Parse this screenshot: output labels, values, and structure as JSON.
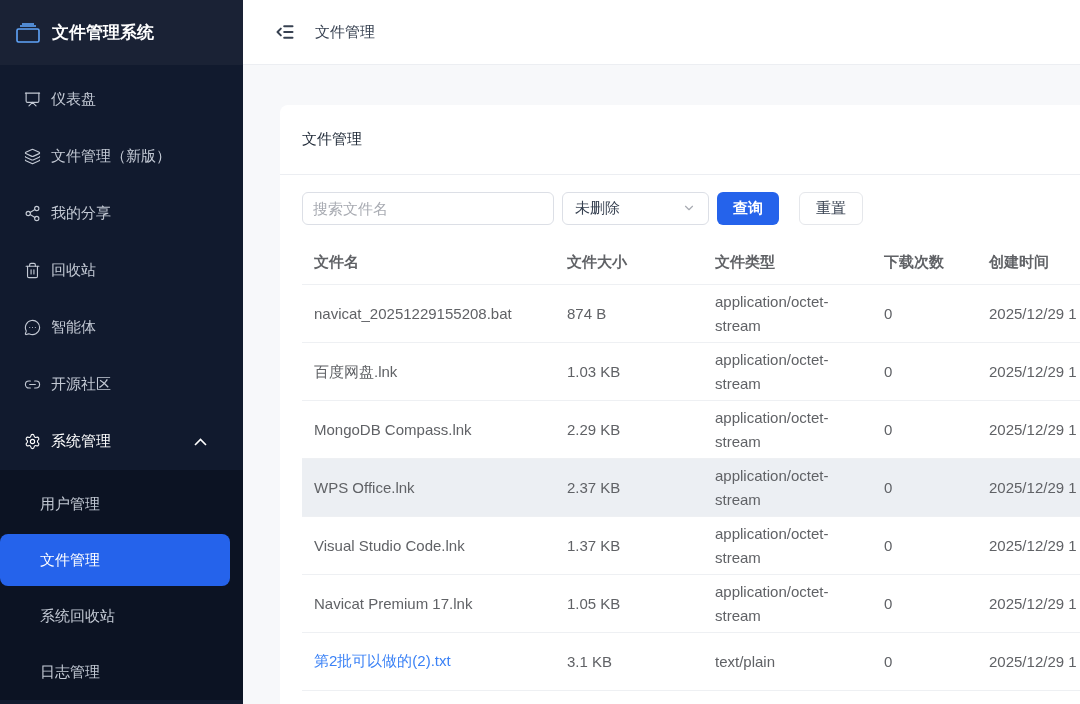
{
  "app": {
    "title": "文件管理系统"
  },
  "sidebar": {
    "items": [
      {
        "label": "仪表盘",
        "selected": false
      },
      {
        "label": "文件管理（新版）",
        "selected": false
      },
      {
        "label": "我的分享",
        "selected": false
      },
      {
        "label": "回收站",
        "selected": false
      },
      {
        "label": "智能体",
        "selected": false
      },
      {
        "label": "开源社区",
        "selected": false
      },
      {
        "label": "系统管理",
        "selected": false,
        "expanded": true,
        "children": [
          {
            "label": "用户管理",
            "selected": false
          },
          {
            "label": "文件管理",
            "selected": true
          },
          {
            "label": "系统回收站",
            "selected": false
          },
          {
            "label": "日志管理",
            "selected": false
          }
        ]
      }
    ]
  },
  "breadcrumb": "文件管理",
  "card": {
    "title": "文件管理"
  },
  "filters": {
    "search": {
      "placeholder": "搜索文件名"
    },
    "status": {
      "value": "未删除"
    },
    "buttons": [
      {
        "label": "查询",
        "kind": "primary"
      },
      {
        "label": "重置",
        "kind": "default"
      }
    ]
  },
  "table": {
    "columns": [
      "文件名",
      "文件大小",
      "文件类型",
      "下载次数",
      "创建时间"
    ],
    "rows": [
      {
        "kind": "text",
        "highlighted": false,
        "cells": [
          "navicat_20251229155208.bat",
          "874 B",
          "application/octet-stream",
          "0",
          "2025/12/29 1"
        ]
      },
      {
        "kind": "text",
        "highlighted": false,
        "cells": [
          "百度网盘.lnk",
          "1.03 KB",
          "application/octet-stream",
          "0",
          "2025/12/29 1"
        ]
      },
      {
        "kind": "text",
        "highlighted": false,
        "cells": [
          "MongoDB Compass.lnk",
          "2.29 KB",
          "application/octet-stream",
          "0",
          "2025/12/29 1"
        ]
      },
      {
        "kind": "text",
        "highlighted": true,
        "cells": [
          "WPS Office.lnk",
          "2.37 KB",
          "application/octet-stream",
          "0",
          "2025/12/29 1"
        ]
      },
      {
        "kind": "text",
        "highlighted": false,
        "cells": [
          "Visual Studio Code.lnk",
          "1.37 KB",
          "application/octet-stream",
          "0",
          "2025/12/29 1"
        ]
      },
      {
        "kind": "text",
        "highlighted": false,
        "cells": [
          "Navicat Premium 17.lnk",
          "1.05 KB",
          "application/octet-stream",
          "0",
          "2025/12/29 1"
        ]
      },
      {
        "kind": "link",
        "highlighted": false,
        "cells": [
          "第2批可以做的(2).txt",
          "3.1 KB",
          "text/plain",
          "0",
          "2025/12/29 1"
        ]
      }
    ]
  }
}
